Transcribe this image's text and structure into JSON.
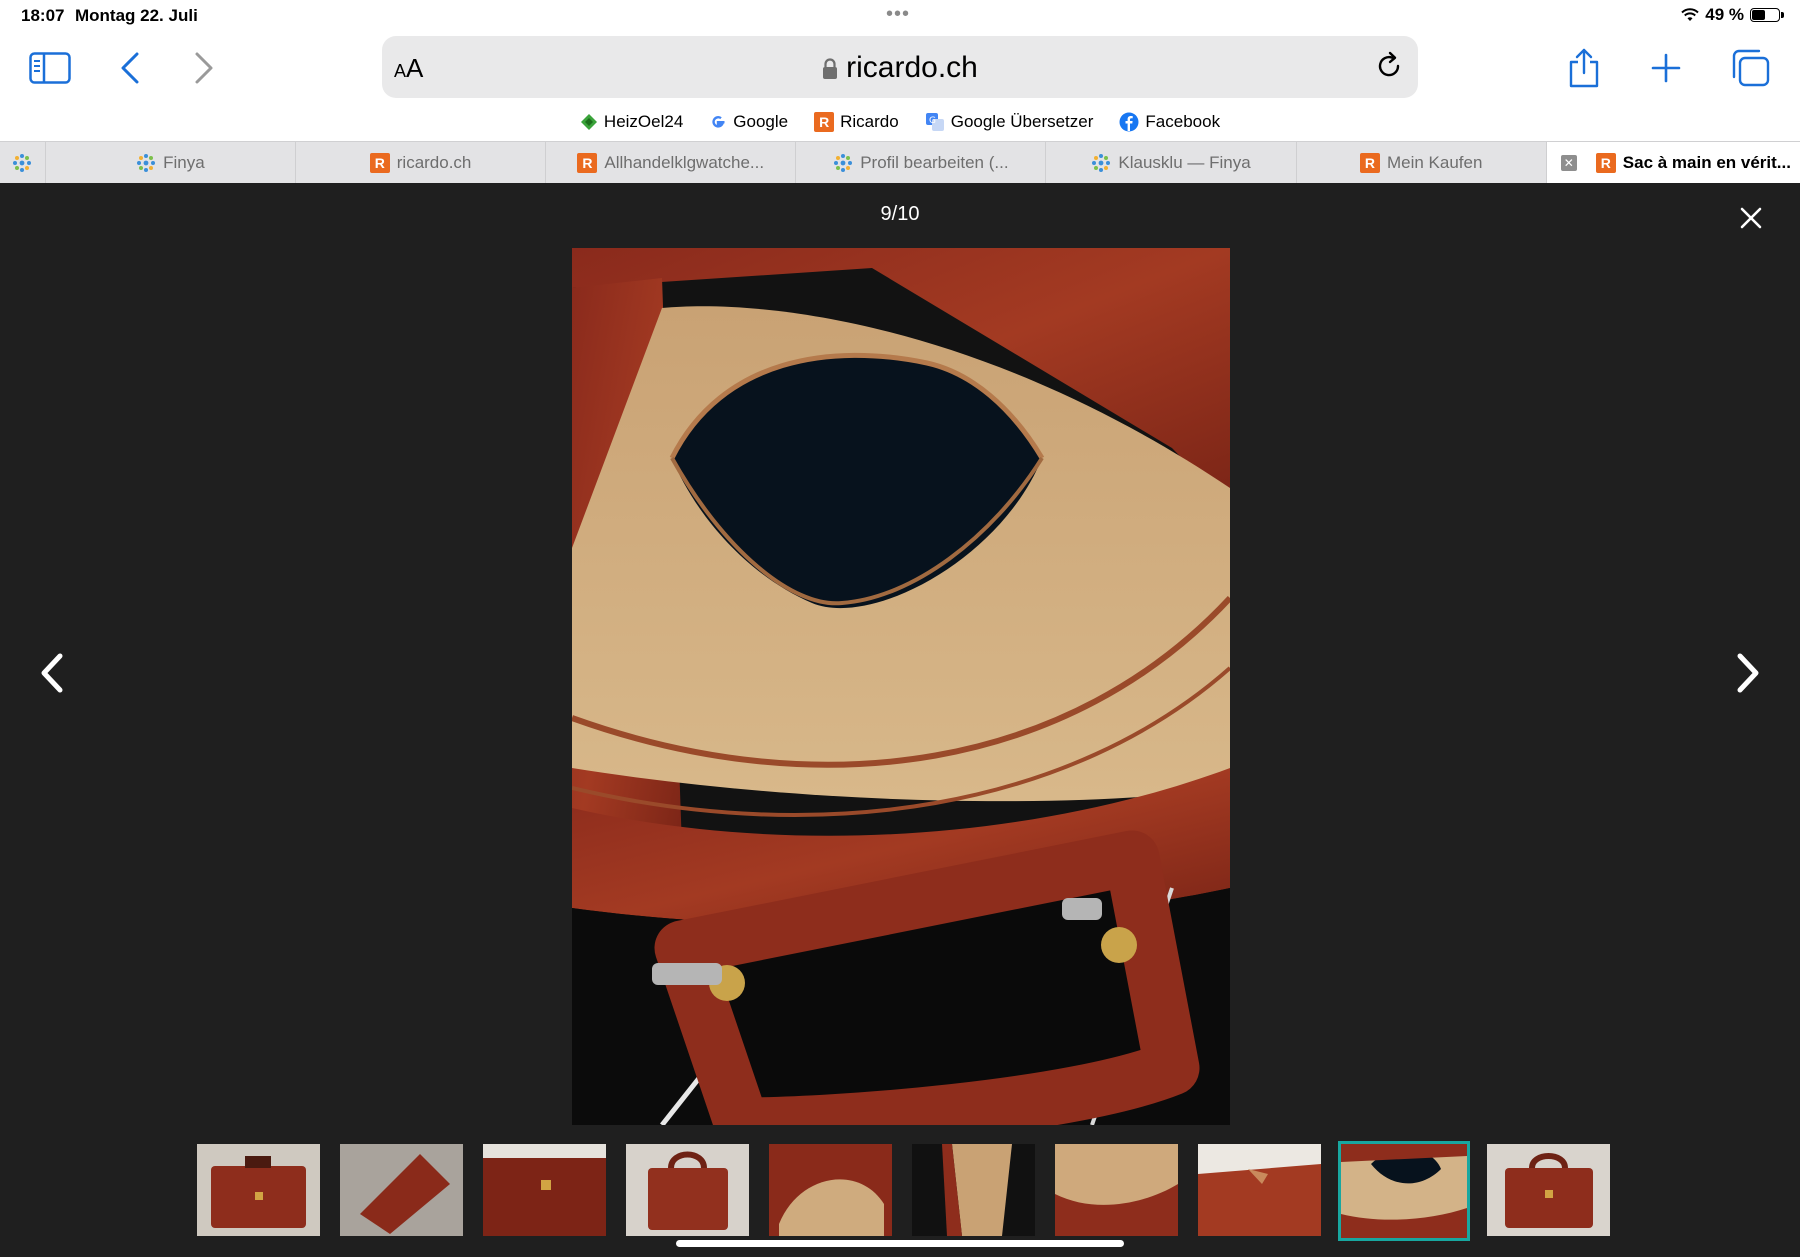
{
  "status": {
    "time": "18:07",
    "date": "Montag 22. Juli",
    "battery": "49 %",
    "battery_level": 0.49
  },
  "urlbar": {
    "aa_label": "AA",
    "domain": "ricardo.ch"
  },
  "bookmarks": [
    {
      "label": "HeizOel24",
      "icon": "heizoel24-icon"
    },
    {
      "label": "Google",
      "icon": "google-icon"
    },
    {
      "label": "Ricardo",
      "icon": "ricardo-icon"
    },
    {
      "label": "Google Übersetzer",
      "icon": "google-translate-icon"
    },
    {
      "label": "Facebook",
      "icon": "facebook-icon"
    }
  ],
  "tabs": [
    {
      "label": "Finya",
      "icon": "finya-icon"
    },
    {
      "label": "ricardo.ch",
      "icon": "ricardo-icon"
    },
    {
      "label": "Allhandelklgwatche...",
      "icon": "ricardo-icon"
    },
    {
      "label": "Profil bearbeiten (...",
      "icon": "finya-icon"
    },
    {
      "label": "Klausklu — Finya",
      "icon": "finya-icon"
    },
    {
      "label": "Mein Kaufen",
      "icon": "ricardo-icon"
    },
    {
      "label": "Sac à main en vérit...",
      "icon": "ricardo-icon",
      "active": true
    }
  ],
  "gallery": {
    "counter": "9/10",
    "current_index": 9,
    "total": 10,
    "thumbnail_count": 10
  },
  "colors": {
    "ricardo_orange": "#ea6a1f",
    "gallery_bg": "#1f1f1f",
    "active_thumb": "#18a7a0",
    "ios_blue": "#1a6fd8"
  }
}
